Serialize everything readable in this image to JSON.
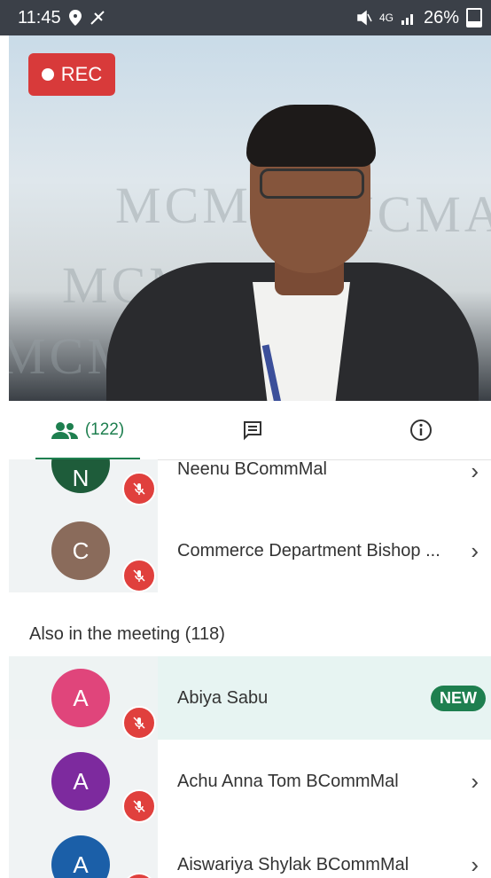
{
  "status_bar": {
    "time": "11:45",
    "battery": "26%",
    "network": "4G"
  },
  "video": {
    "rec_label": "REC",
    "watermark": "MCMAT"
  },
  "tabs": {
    "participants_count": "(122)"
  },
  "participants_top": [
    {
      "initial": "N",
      "name": "Neenu BCommMal",
      "avatar_color": "#1e5c3a"
    },
    {
      "initial": "C",
      "name": "Commerce Department Bishop ...",
      "avatar_color": "#8a6b5b"
    }
  ],
  "also_section": {
    "title": "Also in the meeting (118)"
  },
  "participants_also": [
    {
      "initial": "A",
      "name": "Abiya Sabu",
      "avatar_color": "#e0457b",
      "badge": "NEW"
    },
    {
      "initial": "A",
      "name": "Achu Anna Tom BCommMal",
      "avatar_color": "#7d2a9e"
    },
    {
      "initial": "A",
      "name": "Aiswariya Shylak BCommMal",
      "avatar_color": "#1b5fa8"
    }
  ],
  "colors": {
    "accent": "#1e7f4f",
    "mute_red": "#e0403d",
    "rec_red": "#d83a3a",
    "highlight_row": "#e7f4f2"
  }
}
